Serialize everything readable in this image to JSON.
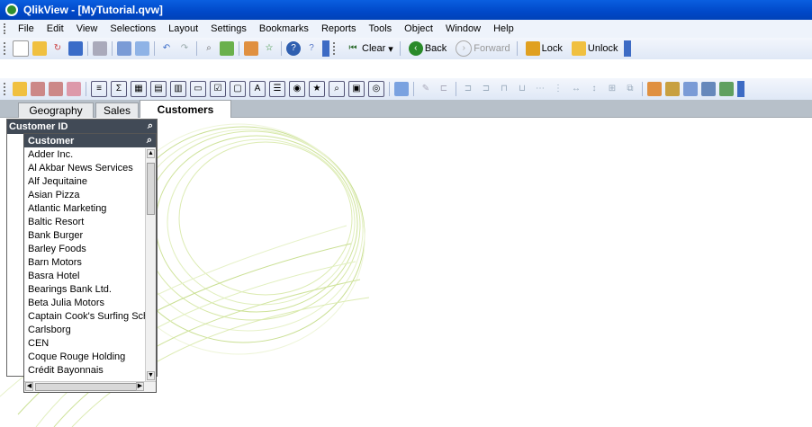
{
  "window": {
    "title": "QlikView - [MyTutorial.qvw]"
  },
  "menu": [
    "File",
    "Edit",
    "View",
    "Selections",
    "Layout",
    "Settings",
    "Bookmarks",
    "Reports",
    "Tools",
    "Object",
    "Window",
    "Help"
  ],
  "toolbar2": {
    "clear": "Clear",
    "back": "Back",
    "forward": "Forward",
    "lock": "Lock",
    "unlock": "Unlock"
  },
  "tabs": [
    "Geography",
    "Sales",
    "Customers"
  ],
  "outer_listbox": {
    "caption": "Customer ID"
  },
  "listbox": {
    "caption": "Customer",
    "items": [
      "Adder Inc.",
      "Al Akbar News Services",
      "Alf Jequitaine",
      "Asian Pizza",
      "Atlantic Marketing",
      "Baltic Resort",
      "Bank Burger",
      "Barley Foods",
      "Barn Motors",
      "Basra Hotel",
      "Bearings Bank Ltd.",
      "Beta Julia Motors",
      "Captain Cook's Surfing Sch",
      "Carlsborg",
      "CEN",
      "Coque Rouge Holding",
      "Crédit Bayonnais"
    ]
  },
  "colors": {
    "title_bar": "#0048c8",
    "caption_bg": "#414a56",
    "tab_strip": "#b7c0c9"
  }
}
